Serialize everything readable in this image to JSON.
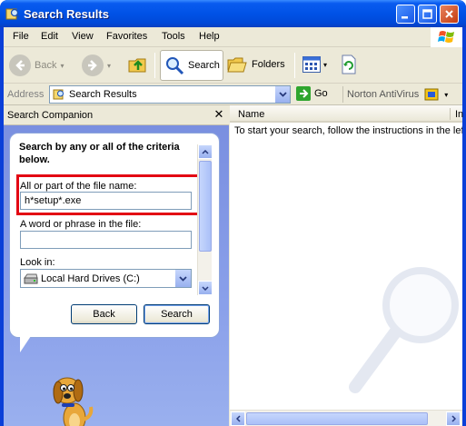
{
  "window": {
    "title": "Search Results"
  },
  "menu": [
    "File",
    "Edit",
    "View",
    "Favorites",
    "Tools",
    "Help"
  ],
  "toolbar": {
    "back": "Back",
    "search": "Search",
    "folders": "Folders"
  },
  "address": {
    "label": "Address",
    "value": "Search Results",
    "go": "Go",
    "norton": "Norton AntiVirus"
  },
  "companion": {
    "title": "Search Companion",
    "heading": "Search by any or all of the criteria below.",
    "filename_label": "All or part of the file name:",
    "filename_value": "h*setup*.exe",
    "phrase_label": "A word or phrase in the file:",
    "phrase_value": "",
    "lookin_label": "Look in:",
    "lookin_value": "Local Hard Drives (C:)",
    "back_button": "Back",
    "search_button": "Search"
  },
  "results": {
    "col_name": "Name",
    "col_in": "In",
    "instructions": "To start your search, follow the instructions in the left pane."
  },
  "colors": {
    "highlight": "#e30613",
    "titlebar": "#0052e6",
    "pane_bg": "#7a8fe0"
  },
  "icons": [
    "search-results-icon",
    "minimize-icon",
    "maximize-icon",
    "close-icon",
    "windows-logo-icon",
    "back-arrow-icon",
    "forward-arrow-icon",
    "up-folder-icon",
    "search-magnifier-icon",
    "folders-icon",
    "views-icon",
    "refresh-icon",
    "go-arrow-icon",
    "norton-icon",
    "hard-drive-icon",
    "rover-dog-icon"
  ]
}
